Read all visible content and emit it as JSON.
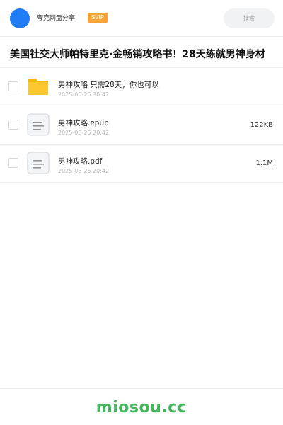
{
  "header": {
    "app_name": "夸克网盘分享",
    "badge": "SVIP",
    "search_placeholder": "搜索"
  },
  "title": "美国社交大师帕特里克·金畅销攻略书！28天练就男神身材",
  "files": [
    {
      "name": "男神攻略 只需28天，你也可以",
      "date": "2025-05-26 20:42",
      "size": "",
      "icon": "folder-icon"
    },
    {
      "name": "男神攻略.epub",
      "date": "2025-05-26 20:42",
      "size": "122KB",
      "icon": "document-icon"
    },
    {
      "name": "男神攻略.pdf",
      "date": "2025-05-26 20:42",
      "size": "1.1M",
      "icon": "document-icon"
    }
  ],
  "footer": {
    "logo": "miosou.cc"
  },
  "colors": {
    "avatar": "#1f7cf4",
    "badge": "#f6a436",
    "folder": "#fbc02d",
    "footer_logo": "#43b55a"
  }
}
